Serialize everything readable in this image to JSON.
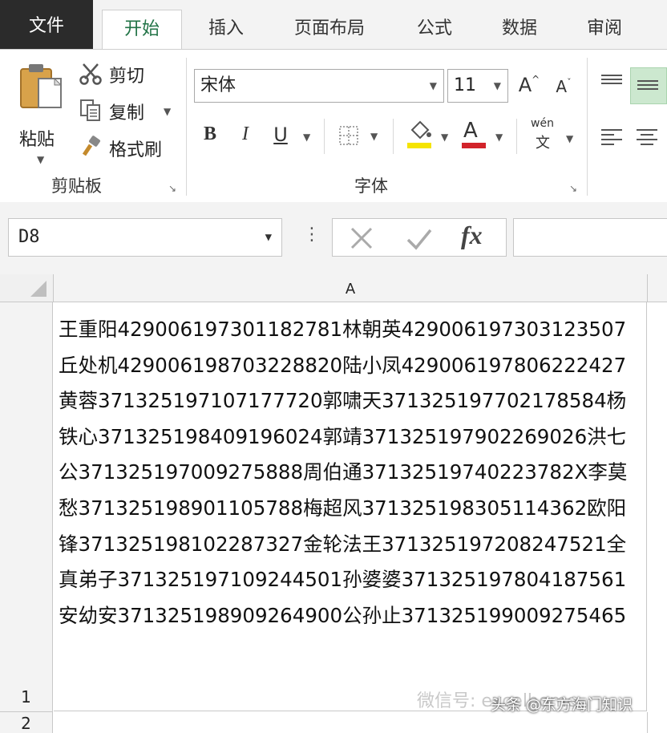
{
  "tabs": [
    {
      "label": "文件"
    },
    {
      "label": "开始"
    },
    {
      "label": "插入"
    },
    {
      "label": "页面布局"
    },
    {
      "label": "公式"
    },
    {
      "label": "数据"
    },
    {
      "label": "审阅"
    }
  ],
  "clipboard": {
    "paste_label": "粘贴",
    "cut_label": "剪切",
    "copy_label": "复制",
    "format_painter_label": "格式刷",
    "group_label": "剪贴板"
  },
  "font": {
    "font_name": "宋体",
    "font_size": "11",
    "bold": "B",
    "italic": "I",
    "underline": "U",
    "phonetic_top": "wén",
    "phonetic_bottom": "文",
    "font_color_letter": "A",
    "grow_letter": "A",
    "shrink_letter": "A",
    "group_label": "字体",
    "highlight_color": "#f5e400",
    "font_color": "#d2232a"
  },
  "formula_bar": {
    "name_box": "D8",
    "fx_label": "fx"
  },
  "sheet": {
    "column_a": "A",
    "row_1": "1",
    "row_2": "2",
    "cell_a1": "王重阳429006197301182781林朝英429006197303123507丘处机429006198703228820陆小凤429006197806222427黄蓉371325197107177720郭啸天371325197702178584杨铁心371325198409196024郭靖371325197902269026洪七公371325197009275888周伯通37132519740223782X李莫愁371325198901105788梅超风371325198305114362欧阳锋371325198102287327金轮法王371325197208247521全真弟子371325197109244501孙婆婆371325197804187561安幼安371325198909264900公孙止371325199009275465"
  },
  "overlay": {
    "watermark": "微信号: excelhome",
    "credit": "头条 @东方海门知识"
  },
  "colors": {
    "accent": "#217346",
    "file_tab": "#2b2b2b"
  }
}
